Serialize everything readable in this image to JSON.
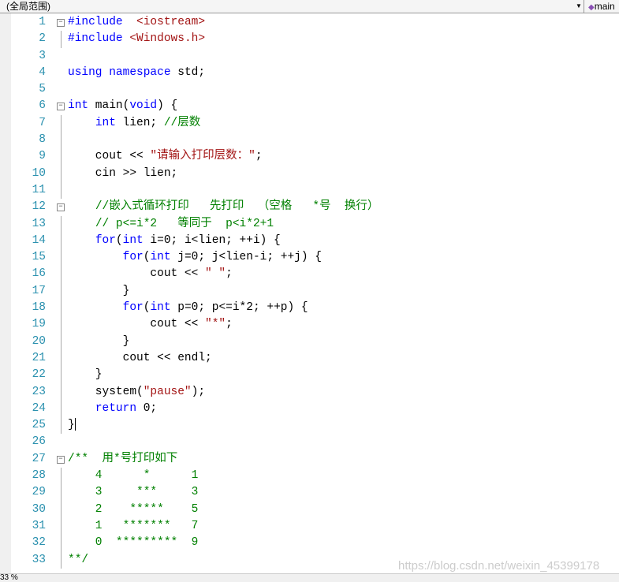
{
  "toolbar": {
    "scope": "(全局范围)",
    "function": "main",
    "function_icon": "method-icon"
  },
  "status": {
    "zoom": "33 %"
  },
  "watermark": "https://blog.csdn.net/weixin_45399178",
  "colors": {
    "keyword": "#0000ff",
    "string": "#a31515",
    "comment": "#008000",
    "line_number": "#2b91af"
  },
  "lines": [
    {
      "n": "1",
      "fold": "open",
      "t": [
        [
          "p",
          "#include"
        ],
        [
          "t",
          "  "
        ],
        [
          "s",
          "<iostream>"
        ]
      ]
    },
    {
      "n": "2",
      "fold": "bar",
      "t": [
        [
          "p",
          "#include"
        ],
        [
          "t",
          " "
        ],
        [
          "s",
          "<Windows.h>"
        ]
      ]
    },
    {
      "n": "3",
      "t": []
    },
    {
      "n": "4",
      "t": [
        [
          "k",
          "using"
        ],
        [
          "t",
          " "
        ],
        [
          "k",
          "namespace"
        ],
        [
          "t",
          " std;"
        ]
      ]
    },
    {
      "n": "5",
      "t": []
    },
    {
      "n": "6",
      "fold": "open",
      "t": [
        [
          "k",
          "int"
        ],
        [
          "t",
          " main("
        ],
        [
          "k",
          "void"
        ],
        [
          "t",
          ") {"
        ]
      ]
    },
    {
      "n": "7",
      "fold": "bar",
      "t": [
        [
          "t",
          "    "
        ],
        [
          "k",
          "int"
        ],
        [
          "t",
          " lien; "
        ],
        [
          "c",
          "//层数"
        ]
      ]
    },
    {
      "n": "8",
      "fold": "bar",
      "t": []
    },
    {
      "n": "9",
      "fold": "bar",
      "t": [
        [
          "t",
          "    cout << "
        ],
        [
          "s",
          "\"请输入打印层数：\""
        ],
        [
          "t",
          ";"
        ]
      ]
    },
    {
      "n": "10",
      "fold": "bar",
      "t": [
        [
          "t",
          "    cin >> lien;"
        ]
      ]
    },
    {
      "n": "11",
      "fold": "bar",
      "t": []
    },
    {
      "n": "12",
      "fold": "open",
      "t": [
        [
          "t",
          "    "
        ],
        [
          "c",
          "//嵌入式循环打印   先打印  （空格   *号  换行）"
        ]
      ]
    },
    {
      "n": "13",
      "fold": "bar",
      "t": [
        [
          "t",
          "    "
        ],
        [
          "c",
          "// p<=i*2   等同于  p<i*2+1"
        ]
      ]
    },
    {
      "n": "14",
      "fold": "bar",
      "t": [
        [
          "t",
          "    "
        ],
        [
          "k",
          "for"
        ],
        [
          "t",
          "("
        ],
        [
          "k",
          "int"
        ],
        [
          "t",
          " i=0; i<lien; ++i) {"
        ]
      ]
    },
    {
      "n": "15",
      "fold": "bar",
      "t": [
        [
          "t",
          "        "
        ],
        [
          "k",
          "for"
        ],
        [
          "t",
          "("
        ],
        [
          "k",
          "int"
        ],
        [
          "t",
          " j=0; j<lien-i; ++j) {"
        ]
      ]
    },
    {
      "n": "16",
      "fold": "bar",
      "t": [
        [
          "t",
          "            cout << "
        ],
        [
          "s",
          "\" \""
        ],
        [
          "t",
          ";"
        ]
      ]
    },
    {
      "n": "17",
      "fold": "bar",
      "t": [
        [
          "t",
          "        }"
        ]
      ]
    },
    {
      "n": "18",
      "fold": "bar",
      "t": [
        [
          "t",
          "        "
        ],
        [
          "k",
          "for"
        ],
        [
          "t",
          "("
        ],
        [
          "k",
          "int"
        ],
        [
          "t",
          " p=0; p<=i*2; ++p) {"
        ]
      ]
    },
    {
      "n": "19",
      "fold": "bar",
      "t": [
        [
          "t",
          "            cout << "
        ],
        [
          "s",
          "\"*\""
        ],
        [
          "t",
          ";"
        ]
      ]
    },
    {
      "n": "20",
      "fold": "bar",
      "t": [
        [
          "t",
          "        }"
        ]
      ]
    },
    {
      "n": "21",
      "fold": "bar",
      "t": [
        [
          "t",
          "        cout << endl;"
        ]
      ]
    },
    {
      "n": "22",
      "fold": "bar",
      "t": [
        [
          "t",
          "    }"
        ]
      ]
    },
    {
      "n": "23",
      "fold": "bar",
      "t": [
        [
          "t",
          "    system("
        ],
        [
          "s",
          "\"pause\""
        ],
        [
          "t",
          ");"
        ]
      ]
    },
    {
      "n": "24",
      "fold": "bar",
      "t": [
        [
          "t",
          "    "
        ],
        [
          "k",
          "return"
        ],
        [
          "t",
          " 0;"
        ]
      ]
    },
    {
      "n": "25",
      "fold": "bar",
      "cursor": true,
      "t": [
        [
          "t",
          "}"
        ]
      ]
    },
    {
      "n": "26",
      "t": []
    },
    {
      "n": "27",
      "fold": "open",
      "t": [
        [
          "c",
          "/**  用*号打印如下"
        ]
      ]
    },
    {
      "n": "28",
      "fold": "bar",
      "t": [
        [
          "c",
          "    4      *      1"
        ]
      ]
    },
    {
      "n": "29",
      "fold": "bar",
      "t": [
        [
          "c",
          "    3     ***     3"
        ]
      ]
    },
    {
      "n": "30",
      "fold": "bar",
      "t": [
        [
          "c",
          "    2    *****    5"
        ]
      ]
    },
    {
      "n": "31",
      "fold": "bar",
      "t": [
        [
          "c",
          "    1   *******   7"
        ]
      ]
    },
    {
      "n": "32",
      "fold": "bar",
      "t": [
        [
          "c",
          "    0  *********  9"
        ]
      ]
    },
    {
      "n": "33",
      "fold": "bar",
      "t": [
        [
          "c",
          "**/"
        ]
      ]
    }
  ]
}
